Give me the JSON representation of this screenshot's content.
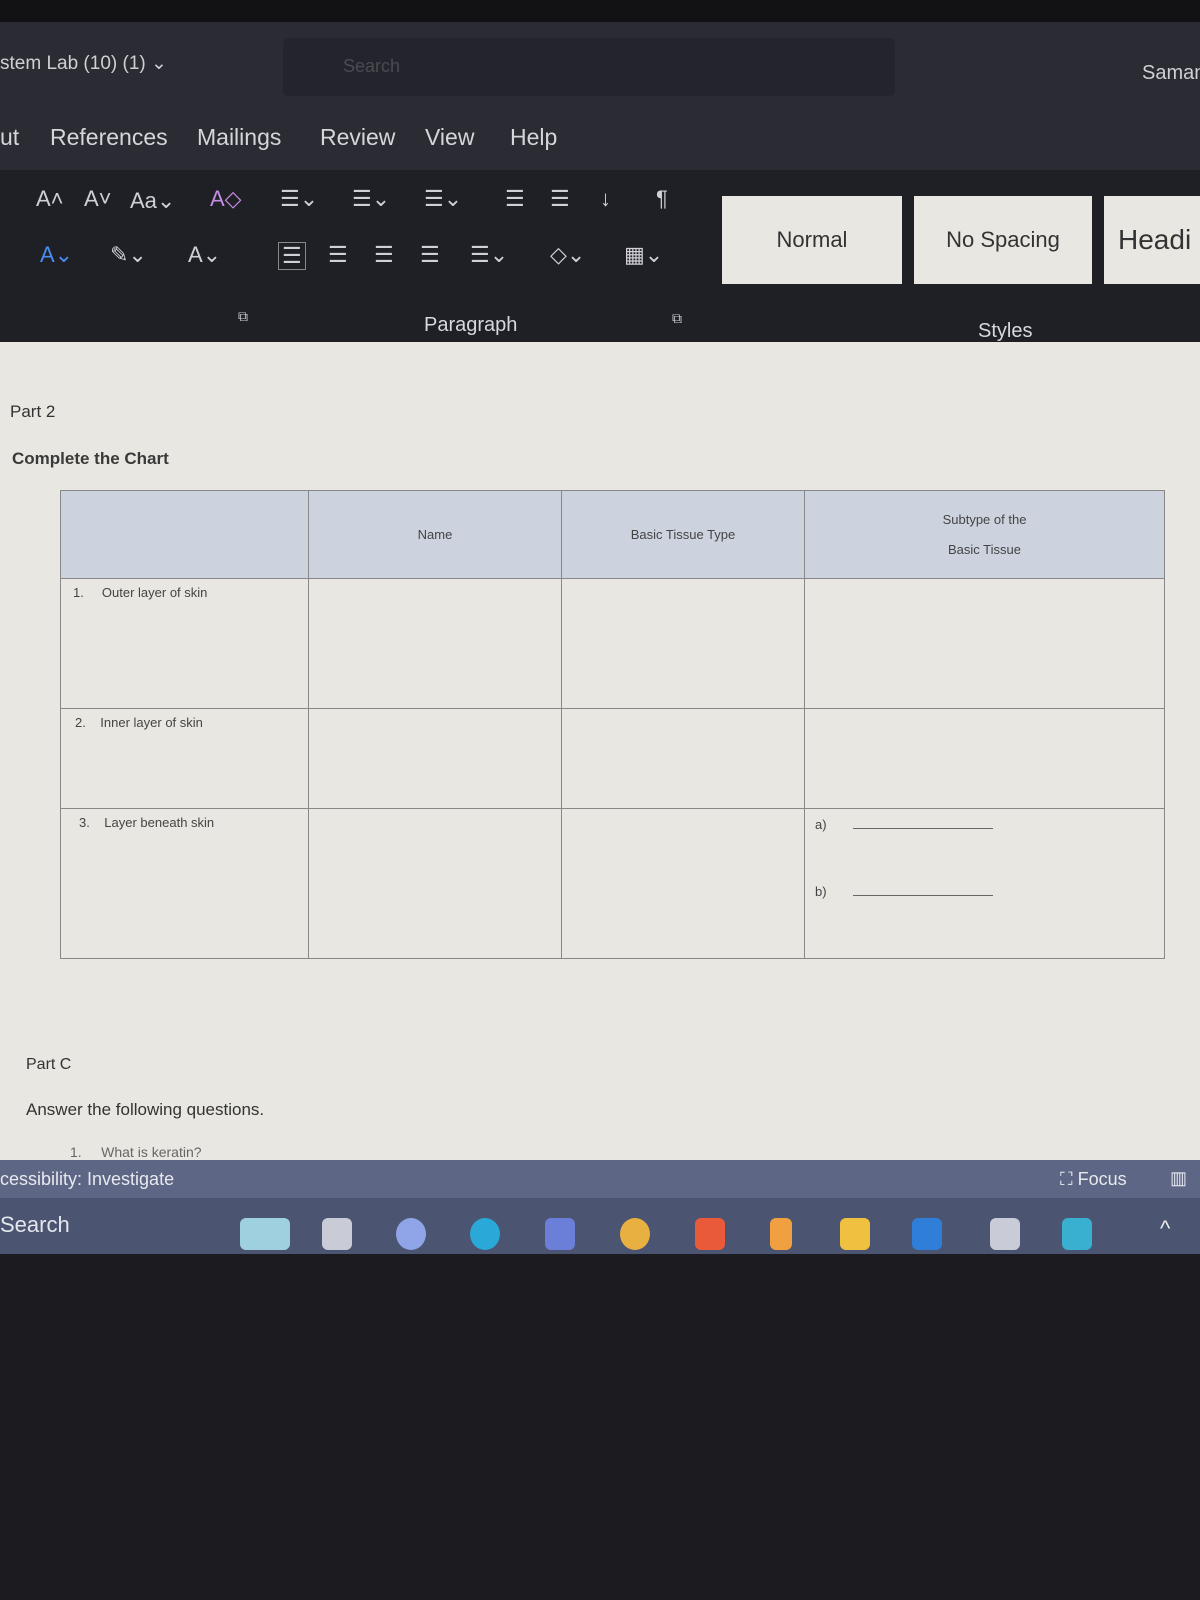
{
  "window": {
    "title": "stem Lab (10) (1)",
    "search_placeholder": "Search",
    "user": "Saman"
  },
  "tabs": [
    "ut",
    "References",
    "Mailings",
    "Review",
    "View",
    "Help"
  ],
  "ribbon": {
    "styles": [
      "Normal",
      "No Spacing",
      "Headi"
    ],
    "groups": {
      "paragraph": "Paragraph",
      "styles": "Styles"
    }
  },
  "document": {
    "part2": "Part 2",
    "instruction": "Complete the Chart",
    "table": {
      "headers": [
        "",
        "Name",
        "Basic Tissue Type",
        "Subtype of the",
        "Basic Tissue"
      ],
      "rows": [
        {
          "num": "1.",
          "label": "Outer layer of skin"
        },
        {
          "num": "2.",
          "label": "Inner layer of skin"
        },
        {
          "num": "3.",
          "label": "Layer beneath skin",
          "sub": [
            "a)",
            "b)"
          ]
        }
      ]
    },
    "partC": "Part C",
    "partC_instruction": "Answer the following questions.",
    "question1_num": "1.",
    "question1": "What is keratin?"
  },
  "status": {
    "accessibility": "cessibility: Investigate",
    "focus": "Focus"
  },
  "taskbar": {
    "search": "Search",
    "accent": "#4b5470"
  }
}
